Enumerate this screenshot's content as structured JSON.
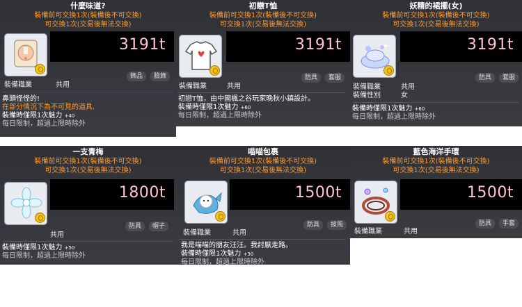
{
  "trade_line1": "裝備前可交換1次(裝備後不可交換)",
  "trade_line2": "可交換1次(交易後無法交換)",
  "job_label": "裝備職業",
  "job_value": "共用",
  "gender_label": "裝備性別",
  "gender_value": "女",
  "charm_line": "裝備時僅限1次魅力",
  "daily_limit": "每日限制，超過上限時除外",
  "items": [
    {
      "name": "什麼味道?",
      "price": "3191t",
      "tags": [
        "飾品",
        "臉飾"
      ],
      "desc1": "鼻頭怪怪的!",
      "desc2": "在部分情況下為不可見的道具.",
      "charm": "+40"
    },
    {
      "name": "初戀T恤",
      "price": "3191t",
      "tags": [
        "防具",
        "套服"
      ],
      "desc1": "初戀T恤，由中國楓之谷玩家晚秋小鎮設計。",
      "charm": "+60"
    },
    {
      "name": "妖精的裙擺(女)",
      "price": "3191t",
      "tags": [
        "防具",
        "套服"
      ],
      "charm": "+60"
    },
    {
      "name": "一支青梅",
      "price": "1800t",
      "tags": [
        "防具",
        "帽子"
      ],
      "charm": "+50"
    },
    {
      "name": "喵喵包裹",
      "price": "1500t",
      "tags": [
        "防具",
        "披風"
      ],
      "desc1": "我是喵喵的朋友汪汪。我討厭走路。",
      "charm": "+30"
    },
    {
      "name": "藍色海洋手環",
      "price": "1500t",
      "tags": [
        "防具",
        "手套"
      ]
    }
  ]
}
